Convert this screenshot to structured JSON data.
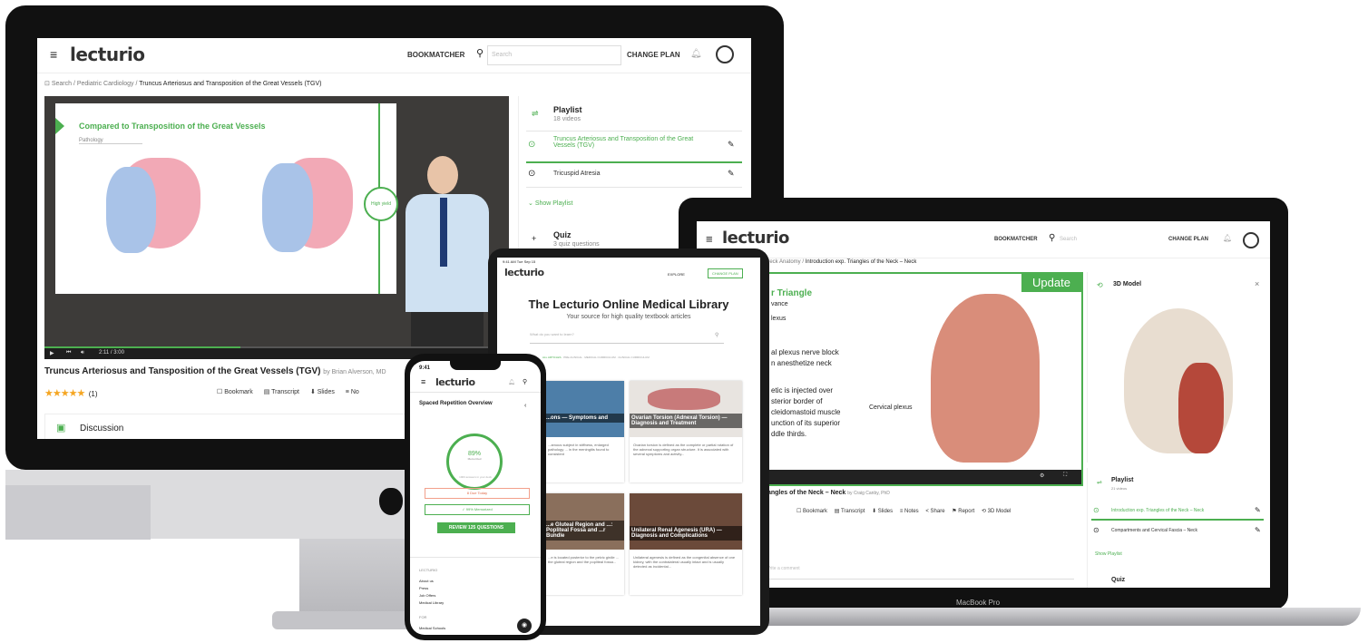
{
  "colors": {
    "accent": "#4caf50",
    "star": "#f5a623",
    "frame": "#111111"
  },
  "desktop": {
    "logo": "lecturio",
    "nav": {
      "bookmatcher": "BOOKMATCHER",
      "search_placeholder": "Search",
      "change_plan": "CHANGE PLAN"
    },
    "breadcrumb": {
      "search": "Search",
      "category": "Pediatric Cardiology",
      "current": "Truncus Arteriosus and Transposition of the Great Vessels (TGV)"
    },
    "video": {
      "slide_title": "Compared to Transposition of the Great Vessels",
      "slide_tag": "Pathology",
      "badge": "High yield",
      "time": "2:11 / 3:00"
    },
    "lecture": {
      "title": "Truncus Arteriosus and Tansposition of the Great Vessels (TGV)",
      "author": "by Brian Alverson, MD",
      "stars": "★★★★★",
      "rating_count": "(1)"
    },
    "actions": {
      "bookmark": "Bookmark",
      "transcript": "Transcript",
      "slides": "Slides",
      "notes": "No"
    },
    "discussion": "Discussion",
    "playlist": {
      "title": "Playlist",
      "count": "18 videos",
      "items": [
        "Truncus Arteriosus and Transposition of the Great Vessels (TGV)",
        "Tricuspid Atresia"
      ],
      "show": "Show Playlist"
    },
    "quiz": {
      "title": "Quiz",
      "sub": "3 quiz questions"
    }
  },
  "laptop": {
    "logo": "lecturio",
    "nav": {
      "bookmatcher": "BOOKMATCHER",
      "search_placeholder": "Search",
      "change_plan": "CHANGE PLAN"
    },
    "breadcrumb": {
      "category": "Neck Anatomy",
      "current": "Introduction exp. Triangles of the Neck – Neck"
    },
    "slide": {
      "title": "r Triangle",
      "sub": "vance",
      "lines": [
        "lexus",
        "al plexus nerve block",
        "n anesthetize neck",
        "etic is injected over",
        "sterior border of",
        "cleidomastoid muscle",
        "unction of its superior",
        "ddle thirds."
      ],
      "update": "Update",
      "label": "Cervical plexus"
    },
    "lecture": {
      "title": "iangles of the Neck – Neck",
      "author": "by Craig Canby, PhD"
    },
    "actions": [
      "Bookmark",
      "Transcript",
      "Slides",
      "Notes",
      "Share",
      "Report",
      "3D Model"
    ],
    "model_title": "3D Model",
    "playlist": {
      "title": "Playlist",
      "count": "21 videos",
      "items": [
        "Introduction exp. Triangles of the Neck – Neck",
        "Compartments and Cervical Fascia – Neck"
      ],
      "show": "Show Playlist"
    },
    "quiz": "Quiz",
    "comment_placeholder": "Write a comment",
    "brand": "MacBook Pro"
  },
  "tablet": {
    "status_time": "9:41 AM Tue Sep 15",
    "logo": "lecturio",
    "nav": [
      "EXPLORE",
      "CHANGE PLAN"
    ],
    "title": "The Lecturio Online Medical Library",
    "subtitle": "Your source for high quality textbook articles",
    "search_placeholder": "What do you want to learn?",
    "tabs": [
      "ALL ARTICLES",
      "PRE-CLINICAL",
      "MEDICAL CURRICULUM",
      "CLINICAL CURRICULUM"
    ],
    "cards": [
      {
        "title": "...ons — Symptoms and",
        "body": "...amous subject in stiffness, enlarged pathology ... in the meningitis found to consistent"
      },
      {
        "title": "Ovarian Torsion (Adnexal Torsion) — Diagnosis and Treatment",
        "body": "Ovarian torsion is defined as the complete or partial rotation of the adnexal supporting organ structure. It is associated with several symptoms and activity..."
      },
      {
        "title": "...e Gluteal Region and ...: Popliteal Fossa and ...r Bundle",
        "body": "...e is located posterior to the pelvic girdle ... the gluteal region and the popliteal fossa..."
      },
      {
        "title": "Unilateral Renal Agenesis (URA) — Diagnosis and Complications",
        "body": "Unilateral agenesis is defined as the congenital absence of one kidney, with the contralateral usually intact and is usually detected as incidental..."
      }
    ]
  },
  "phone": {
    "time": "9:41",
    "logo": "lecturio",
    "title": "Spaced Repetition Overview",
    "progress": "89%",
    "progress_value": 0.89,
    "progress_sub": "Memorized",
    "hint": "1903 answers in your deck",
    "due": "8 Due Today",
    "memorized": "✓ 99% Memorized",
    "cta": "REVIEW 125 QUESTIONS",
    "footer_heading": "LECTURIO",
    "footer_links": [
      "About us",
      "Press",
      "Job Offers",
      "Medical Library"
    ],
    "footer_heading2": "FOR",
    "footer_links2": [
      "Medical Schools"
    ]
  }
}
